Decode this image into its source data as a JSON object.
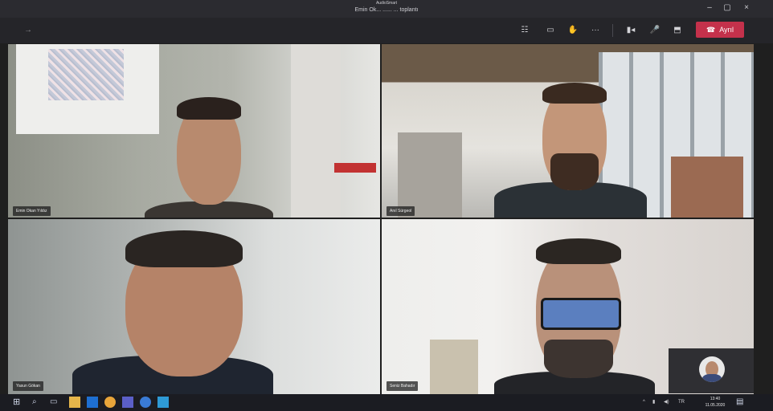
{
  "window": {
    "title_small": "AudioSmart",
    "title": "Emin Ok... ...... ... toplantı"
  },
  "participants": [
    {
      "name": "Emin Okan Yıldız"
    },
    {
      "name": "Anıl Sürgeol"
    },
    {
      "name": "Yasun Gökan"
    },
    {
      "name": "Seniz Bahadır"
    }
  ],
  "toolbar": {
    "leave_label": "Ayrıl",
    "icons": [
      "people-icon",
      "chat-icon",
      "raise-hand-icon",
      "more-icon",
      "camera-icon",
      "mic-icon",
      "share-icon"
    ]
  },
  "colors": {
    "leave": "#c4314b",
    "titlebar": "#2b2b30",
    "toolbar": "#252529",
    "taskbar": "#1b1c22"
  },
  "taskbar": {
    "time": "13:40",
    "date": "11.05.2020"
  }
}
